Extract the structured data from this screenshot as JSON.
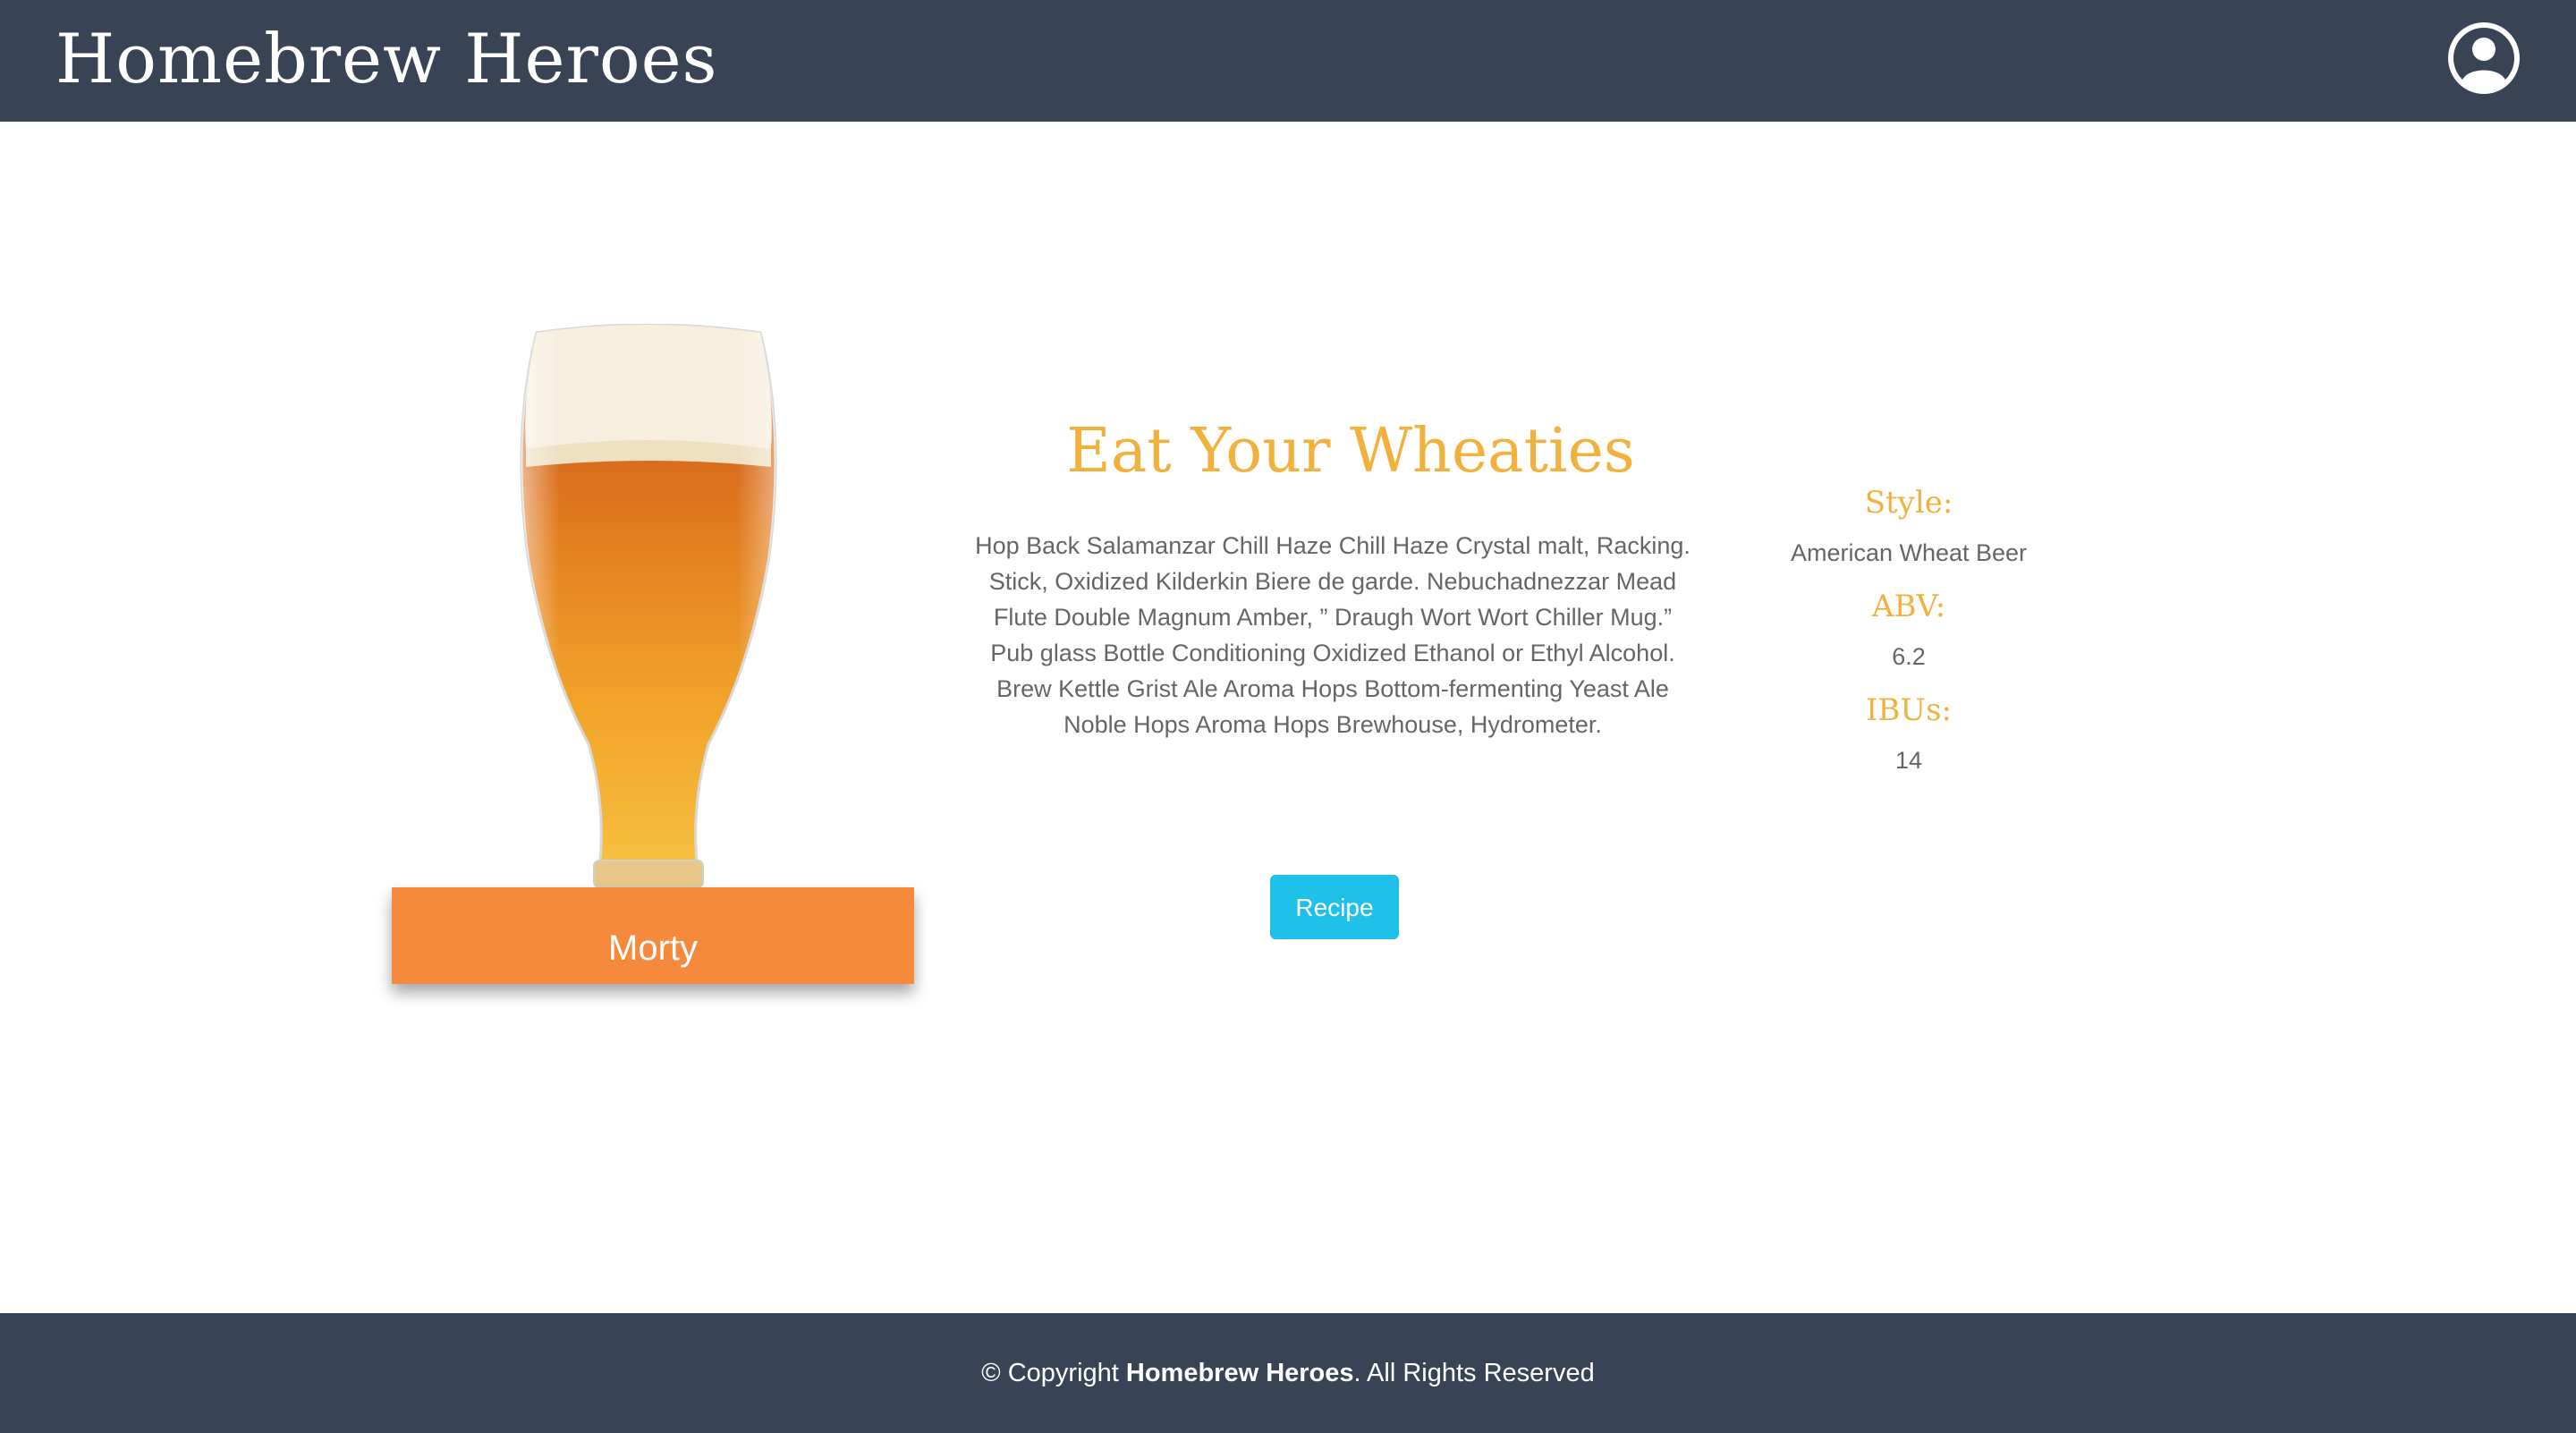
{
  "header": {
    "brand": "Homebrew Heroes",
    "user_icon": "user-circle-icon"
  },
  "beer": {
    "image_icon": "beer-glass-image",
    "brewer": "Morty",
    "name": "Eat Your Wheaties",
    "description": "Hop Back Salamanzar Chill Haze Chill Haze Crystal malt, Racking. Stick, Oxidized Kilderkin Biere de garde. Nebuchadnezzar Mead Flute Double Magnum Amber, ” Draugh Wort Wort Chiller Mug.” Pub glass Bottle Conditioning Oxidized Ethanol or Ethyl Alcohol. Brew Kettle Grist Ale Aroma Hops Bottom-fermenting Yeast Ale Noble Hops Aroma Hops Brewhouse, Hydrometer.",
    "recipe_button": "Recipe"
  },
  "stats": {
    "style_label": "Style:",
    "style_value": "American Wheat Beer",
    "abv_label": "ABV:",
    "abv_value": "6.2",
    "ibu_label": "IBUs:",
    "ibu_value": "14"
  },
  "footer": {
    "copyright_prefix": "© Copyright ",
    "copyright_brand": "Homebrew Heroes",
    "copyright_suffix": ". All Rights Reserved"
  },
  "colors": {
    "header_bg": "#384455",
    "accent_gold": "#f2b13c",
    "tag_orange": "#f5893c",
    "button_cyan": "#1fc1e8"
  }
}
